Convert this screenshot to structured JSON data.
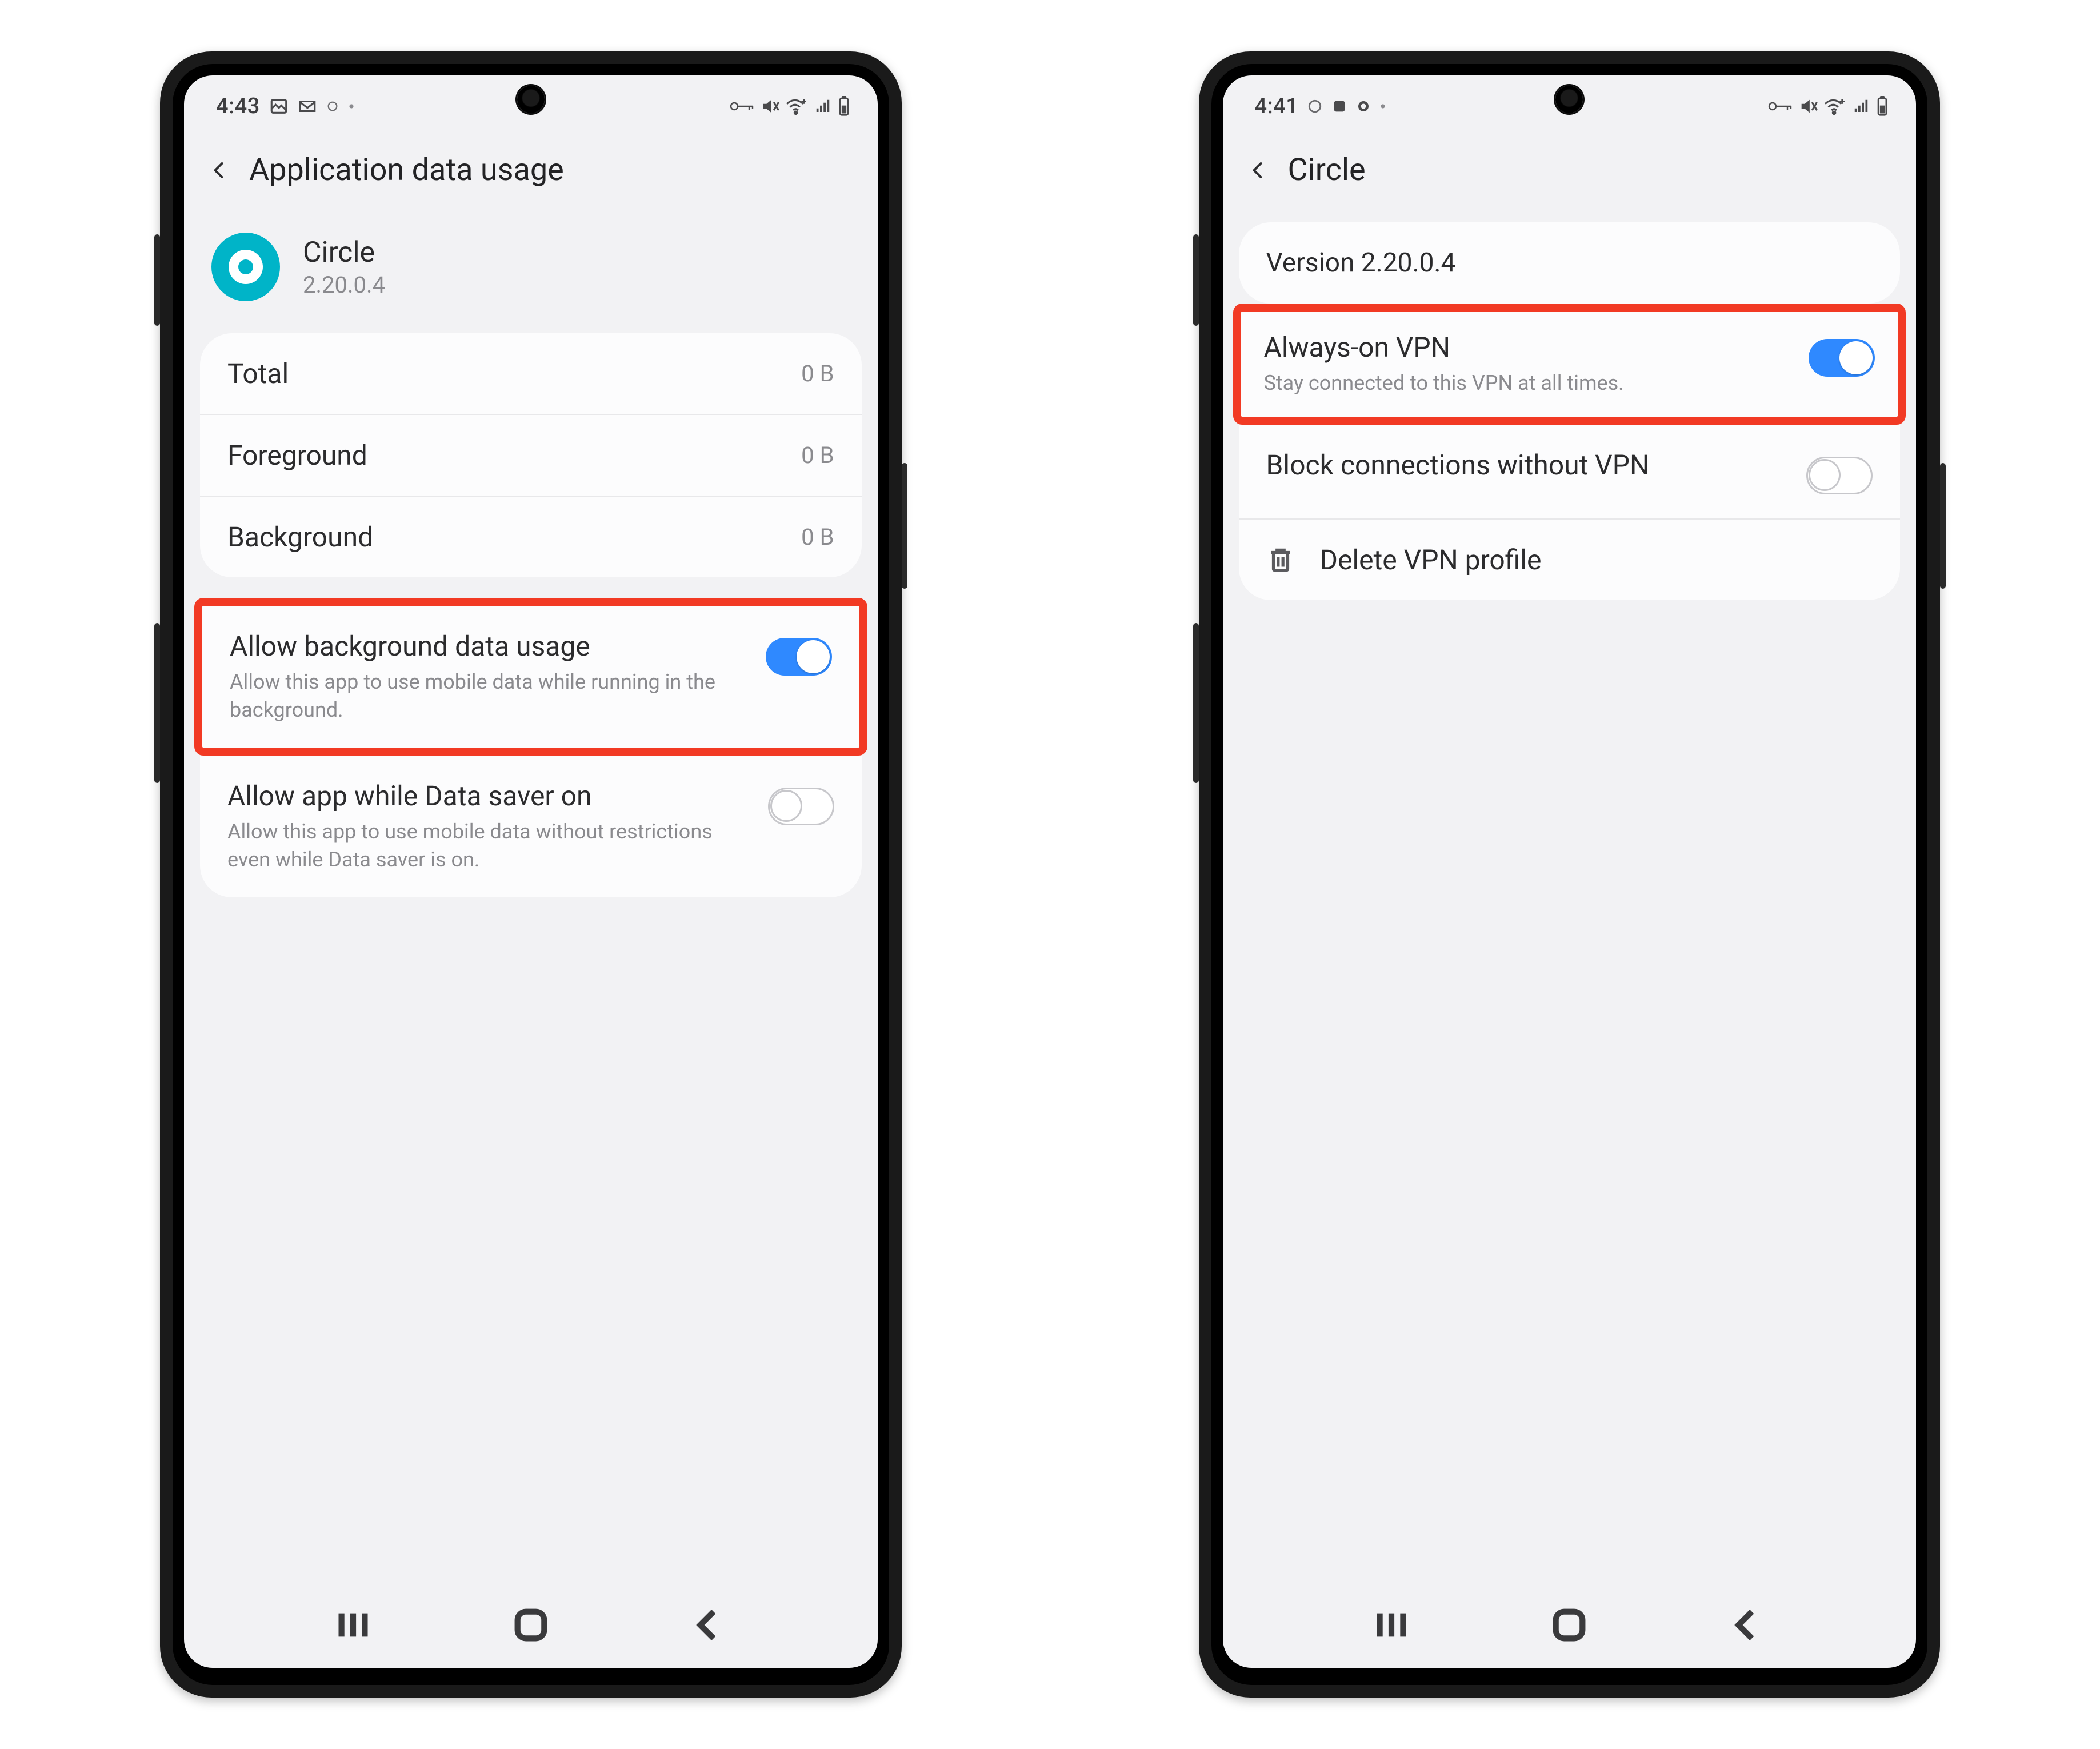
{
  "screen1": {
    "status": {
      "time": "4:43"
    },
    "header": {
      "title": "Application data usage"
    },
    "app": {
      "name": "Circle",
      "version": "2.20.0.4"
    },
    "stats": {
      "total": {
        "label": "Total",
        "value": "0 B"
      },
      "fg": {
        "label": "Foreground",
        "value": "0 B"
      },
      "bg": {
        "label": "Background",
        "value": "0 B"
      }
    },
    "toggles": {
      "bgdata": {
        "title": "Allow background data usage",
        "desc": "Allow this app to use mobile data while running in the background.",
        "on": true
      },
      "datasaver": {
        "title": "Allow app while Data saver on",
        "desc": "Allow this app to use mobile data without restrictions even while Data saver is on.",
        "on": false
      }
    }
  },
  "screen2": {
    "status": {
      "time": "4:41"
    },
    "header": {
      "title": "Circle"
    },
    "version": {
      "label": "Version 2.20.0.4"
    },
    "toggles": {
      "always": {
        "title": "Always-on VPN",
        "desc": "Stay connected to this VPN at all times.",
        "on": true
      },
      "block": {
        "title": "Block connections without VPN",
        "on": false
      }
    },
    "delete": {
      "label": "Delete VPN profile"
    }
  }
}
